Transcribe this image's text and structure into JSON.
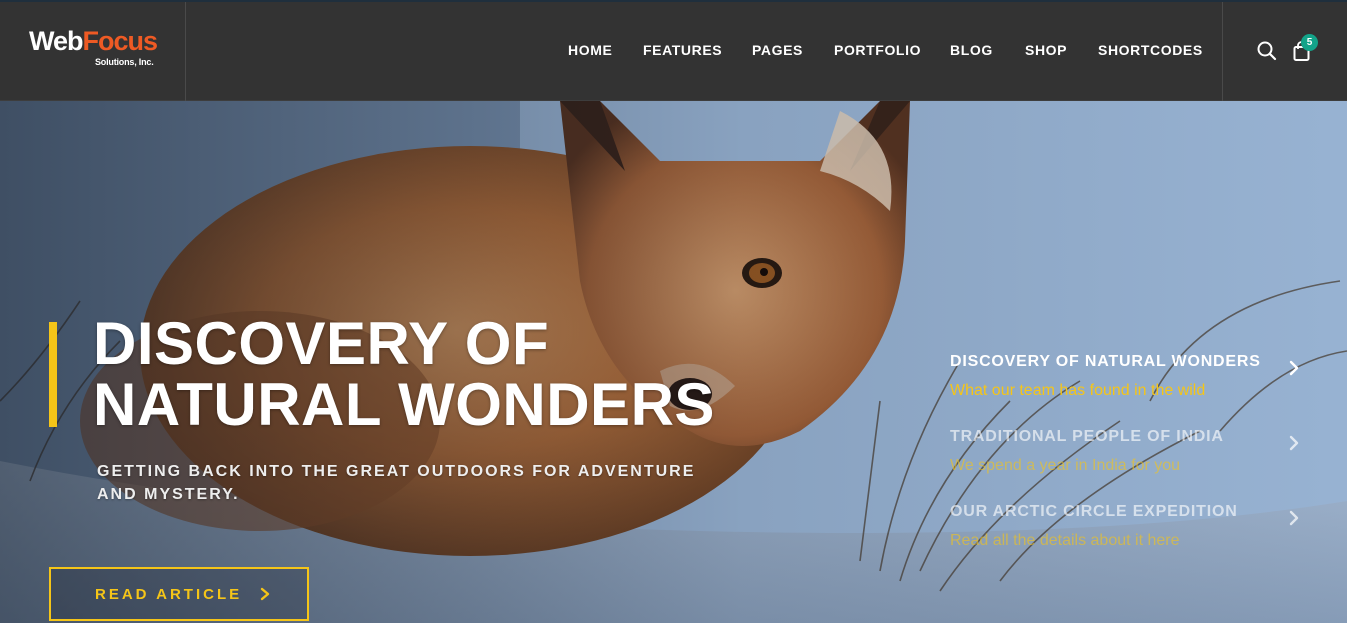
{
  "brand": {
    "name_part1": "Web",
    "name_part2": "Focus",
    "tagline": "Solutions, Inc.",
    "accent_color": "#ee5a24"
  },
  "nav": {
    "items": [
      "HOME",
      "FEATURES",
      "PAGES",
      "PORTFOLIO",
      "BLOG",
      "SHOP",
      "SHORTCODES"
    ]
  },
  "utility": {
    "search_icon": "search-icon",
    "cart_icon": "shopping-bag-icon",
    "cart_count": "5",
    "badge_color": "#13a389"
  },
  "hero": {
    "title_line1": "DISCOVERY OF",
    "title_line2": "NATURAL WONDERS",
    "subtitle": "GETTING BACK INTO THE GREAT OUTDOORS FOR ADVENTURE AND MYSTERY.",
    "cta_label": "READ ARTICLE",
    "accent_color": "#f5c518"
  },
  "slides": [
    {
      "title": "DISCOVERY OF NATURAL WONDERS",
      "subtitle": "What our team has found in the wild",
      "active": true
    },
    {
      "title": "TRADITIONAL PEOPLE OF INDIA",
      "subtitle": "We spend a year in India for you",
      "active": false
    },
    {
      "title": "OUR ARCTIC CIRCLE EXPEDITION",
      "subtitle": "Read all the details about it here",
      "active": false
    }
  ]
}
